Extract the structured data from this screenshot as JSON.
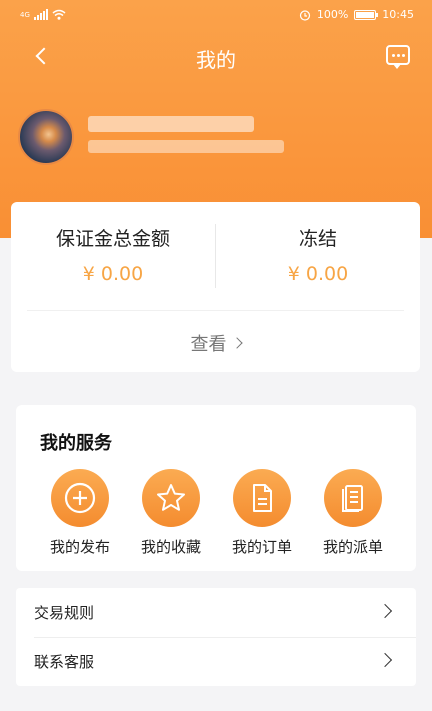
{
  "status_bar": {
    "signal_label": "4G",
    "battery_percent": "100%",
    "time": "10:45"
  },
  "header": {
    "title": "我的",
    "back_icon": "chevron-left-icon",
    "message_icon": "chat-bubble-icon"
  },
  "profile": {
    "name": "",
    "subtitle": ""
  },
  "balance": {
    "deposit_label": "保证金总金额",
    "deposit_value": "¥ 0.00",
    "frozen_label": "冻结",
    "frozen_value": "¥ 0.00",
    "view_label": "查看"
  },
  "services": {
    "title": "我的服务",
    "items": [
      {
        "label": "我的发布",
        "icon": "plus-circle-icon"
      },
      {
        "label": "我的收藏",
        "icon": "star-icon"
      },
      {
        "label": "我的订单",
        "icon": "document-icon"
      },
      {
        "label": "我的派单",
        "icon": "list-document-icon"
      }
    ]
  },
  "menu": [
    {
      "label": "交易规则"
    },
    {
      "label": "联系客服"
    }
  ],
  "colors": {
    "brand": "#f98f34",
    "amount": "#f7a545"
  }
}
